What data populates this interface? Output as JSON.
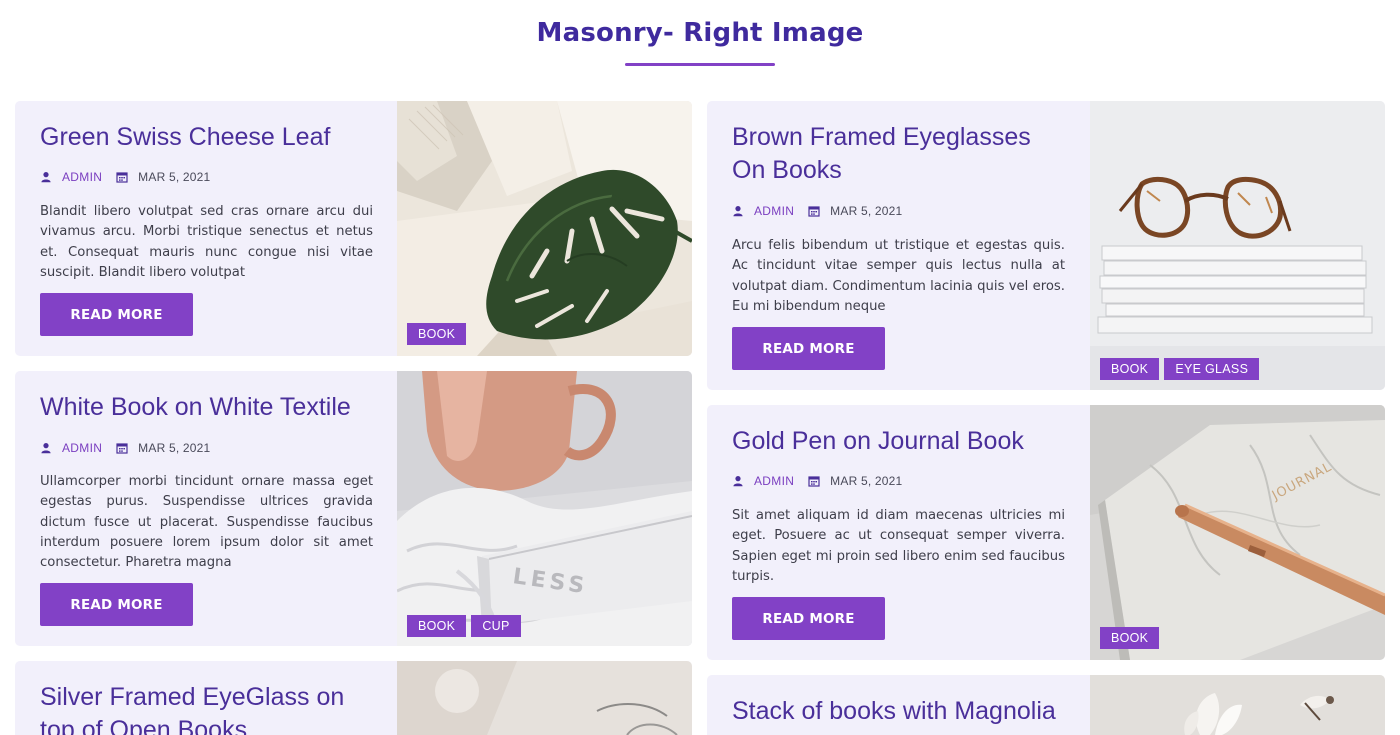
{
  "page": {
    "title": "Masonry- Right Image"
  },
  "posts": [
    {
      "title": "Green Swiss Cheese Leaf",
      "author": "ADMIN",
      "date": "MAR 5, 2021",
      "excerpt": "Blandit libero volutpat sed cras ornare arcu dui vivamus arcu. Morbi tristique senectus et netus et. Consequat mauris nunc congue nisi vitae suscipit. Blandit libero volutpat",
      "button": "READ MORE",
      "tags": [
        "BOOK"
      ]
    },
    {
      "title": "Brown Framed Eyeglasses On Books",
      "author": "ADMIN",
      "date": "MAR 5, 2021",
      "excerpt": "Arcu felis bibendum ut tristique et egestas quis. Ac tincidunt vitae semper quis lectus nulla at volutpat diam. Condimentum lacinia quis vel eros. Eu mi bibendum neque",
      "button": "READ MORE",
      "tags": [
        "BOOK",
        "EYE GLASS"
      ]
    },
    {
      "title": "White Book on White Textile",
      "author": "ADMIN",
      "date": "MAR 5, 2021",
      "excerpt": "Ullamcorper morbi tincidunt ornare massa eget egestas purus. Suspendisse ultrices gravida dictum fusce ut placerat. Suspendisse faucibus interdum posuere lorem ipsum dolor sit amet consectetur. Pharetra magna",
      "button": "READ MORE",
      "tags": [
        "BOOK",
        "CUP"
      ]
    },
    {
      "title": "Gold Pen on Journal Book",
      "author": "ADMIN",
      "date": "MAR 5, 2021",
      "excerpt": "Sit amet aliquam id diam maecenas ultricies mi eget. Posuere ac ut consequat semper viverra. Sapien eget mi proin sed libero enim sed faucibus turpis.",
      "button": "READ MORE",
      "tags": [
        "BOOK"
      ]
    },
    {
      "title": "Silver Framed EyeGlass on top of Open Books"
    },
    {
      "title": "Stack of books with Magnolia"
    }
  ],
  "image_text": {
    "book_spine": "LESS",
    "journal_cover": "JOURNAL"
  },
  "icons": {
    "author": "user-icon",
    "date": "calendar-icon"
  },
  "colors": {
    "accent": "#8241c6",
    "title": "#3f2a9e",
    "card_bg": "#f2f0fb"
  }
}
